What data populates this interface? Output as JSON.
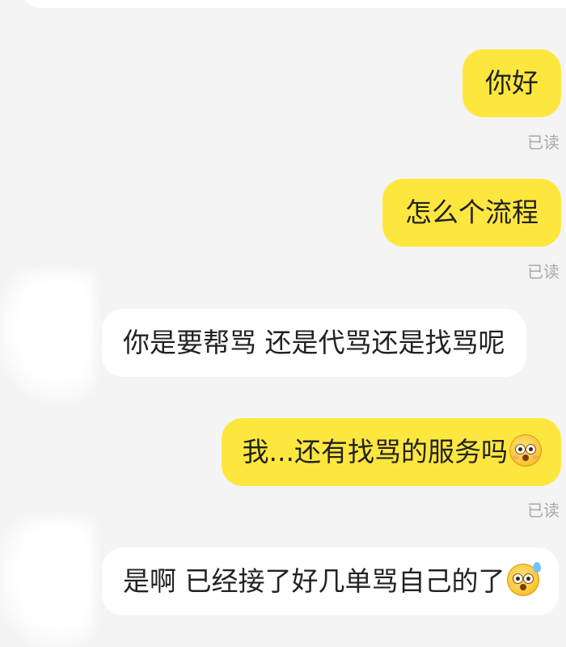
{
  "messages": [
    {
      "side": "me",
      "text": "你好",
      "status": "已读"
    },
    {
      "side": "me",
      "text": "怎么个流程",
      "status": "已读"
    },
    {
      "side": "them",
      "text": "你是要帮骂 还是代骂还是找骂呢"
    },
    {
      "side": "me",
      "text": "我...还有找骂的服务吗",
      "emoji": "flushed-face-icon",
      "status": "已读"
    },
    {
      "side": "them",
      "text": "是啊 已经接了好几单骂自己的了",
      "emoji": "dizzy-sweat-face-icon"
    }
  ],
  "colors": {
    "background": "#f4f4f4",
    "my_bubble": "#fde73f",
    "their_bubble": "#ffffff",
    "read_status": "#a8a8a8"
  }
}
